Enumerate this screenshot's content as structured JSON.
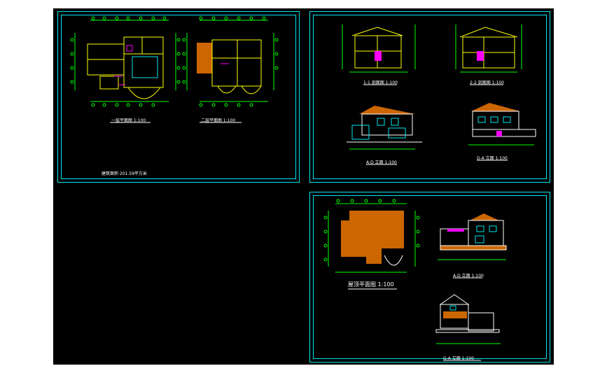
{
  "labels": {
    "plan1": "一层平面图 1:100",
    "plan2": "二层平面图 1:100",
    "roof_plan": "屋顶平面图 1:100",
    "area_note": "建筑面积 201.59平方米",
    "section1": "1-1 剖面图 1:100",
    "section2": "2-2 剖面图 1:100",
    "elev_a": "A-D 立面 1:100",
    "elev_b": "D-A 立面 1:100",
    "elev_c": "A-D 立面 1:100",
    "elev_d": "G-A 立面 1:100"
  },
  "colors": {
    "frame": "#00e5ee",
    "wall": "#ffff00",
    "dim": "#00ff00",
    "roof": "#cc6600",
    "accent": "#ff00ff",
    "text": "#ffffff"
  }
}
